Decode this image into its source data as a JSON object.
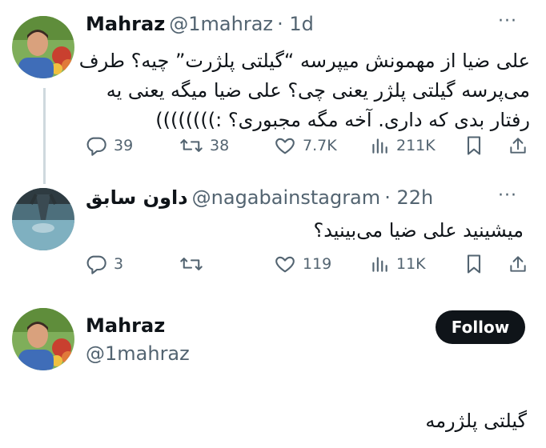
{
  "tweet1": {
    "name": "Mahraz",
    "handle": "@1mahraz",
    "time": "· 1d",
    "more": "···",
    "lines": [
      "علی ضیا از مهمونش میپرسه “گیلتی پلژرت” چیه؟ طرف",
      "می‌پرسه گیلتی پلژر یعنی چی؟ علی ضیا میگه یعنی یه",
      "رفتار بدی که داری. آخه مگه مجبوری؟ :))))))))"
    ],
    "replies": "39",
    "reposts": "38",
    "likes": "7.7K",
    "views": "211K"
  },
  "tweet2": {
    "name": "داون سابق",
    "handle": "@nagabainstagram",
    "time": "· 22h",
    "more": "···",
    "text": "میشینید علی ضیا می‌بینید؟",
    "replies": "3",
    "reposts": "",
    "likes": "119",
    "views": "11K"
  },
  "tweet3": {
    "name": "Mahraz",
    "handle": "@1mahraz",
    "follow_label": "Follow",
    "text": "گیلتی پلژرمه"
  },
  "icons": {
    "reply": "reply-icon",
    "repost": "repost-icon",
    "like": "heart-icon",
    "views": "views-icon",
    "bookmark": "bookmark-icon",
    "share": "share-icon"
  },
  "colors": {
    "text": "#0f1419",
    "secondary": "#536471",
    "thread_line": "#cfd9de",
    "button_bg": "#0f1419"
  }
}
